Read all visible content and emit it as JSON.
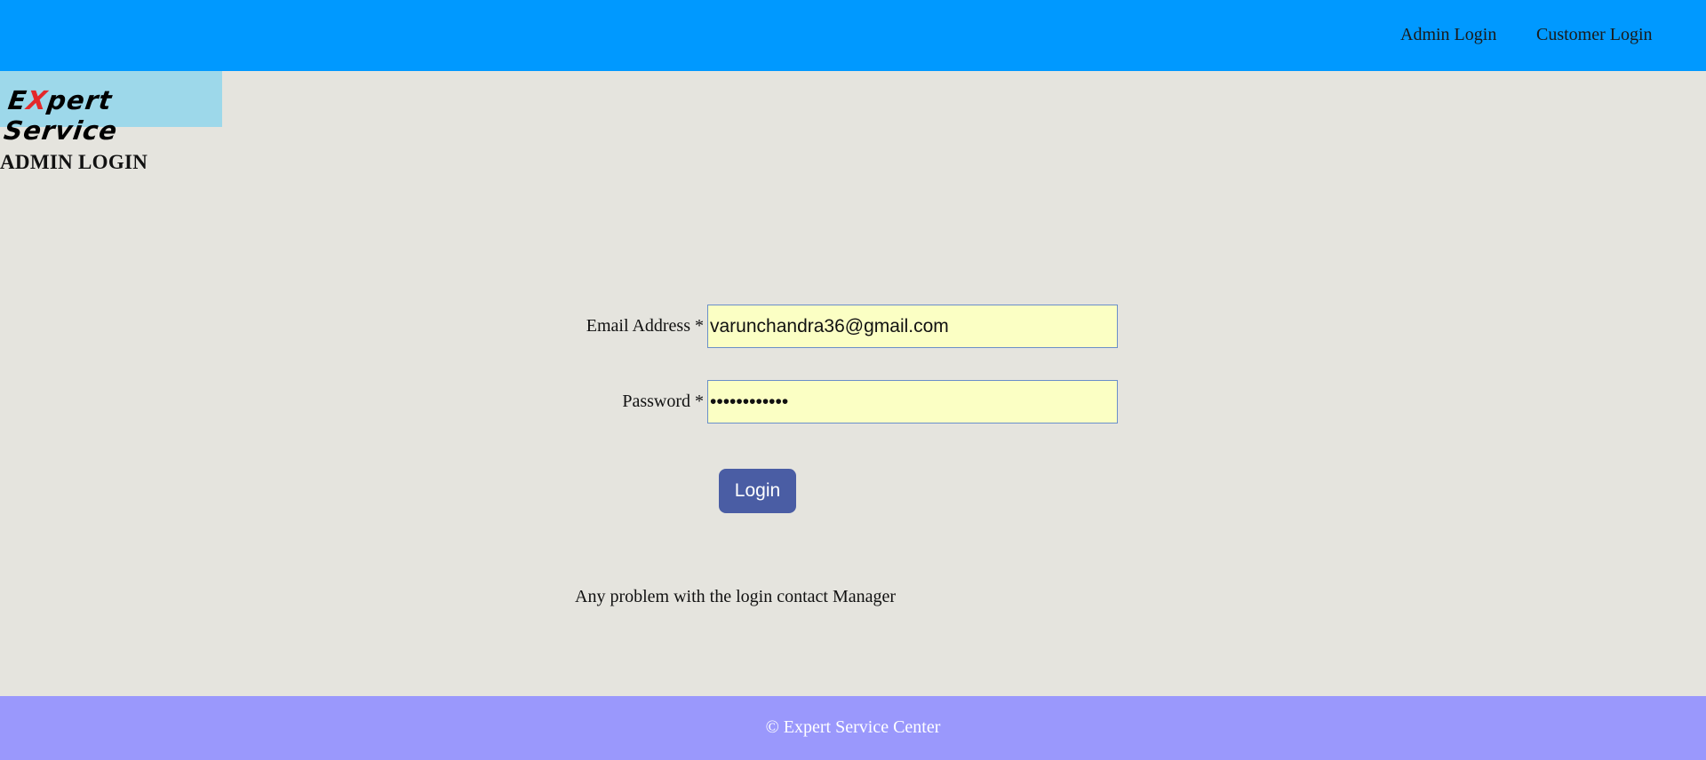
{
  "header": {
    "nav": {
      "admin_login": "Admin Login",
      "customer_login": "Customer Login"
    }
  },
  "logo": {
    "prefix": "E",
    "highlight": "X",
    "rest": "pert Service"
  },
  "page_title": "ADMIN LOGIN",
  "form": {
    "email_label": "Email Address *",
    "email_value": "varunchandra36@gmail.com",
    "password_label": "Password *",
    "password_value": "varunchandra",
    "login_label": "Login"
  },
  "help_text": "Any problem with the login contact Manager",
  "footer": {
    "text": "© Expert Service Center"
  },
  "colors": {
    "header_bg": "#0099ff",
    "page_bg": "#e5e4de",
    "logo_bg": "#9dd8ea",
    "input_bg": "#fbffc4",
    "button_bg": "#4a5da4",
    "footer_bg": "#9a98fc"
  }
}
